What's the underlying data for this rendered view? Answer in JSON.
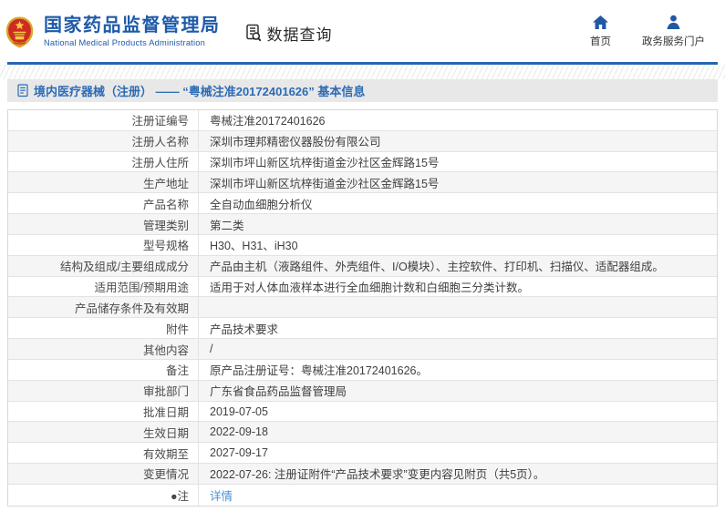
{
  "header": {
    "org_name_zh": "国家药品监督管理局",
    "org_name_en": "National Medical Products Administration",
    "data_query_label": "数据查询",
    "nav_home": "首页",
    "nav_portal": "政务服务门户"
  },
  "breadcrumb": {
    "title": "境内医疗器械（注册） —— “粤械注准20172401626” 基本信息"
  },
  "table": {
    "rows": [
      {
        "label": "注册证编号",
        "value": "粤械注准20172401626"
      },
      {
        "label": "注册人名称",
        "value": "深圳市理邦精密仪器股份有限公司"
      },
      {
        "label": "注册人住所",
        "value": "深圳市坪山新区坑梓街道金沙社区金辉路15号"
      },
      {
        "label": "生产地址",
        "value": "深圳市坪山新区坑梓街道金沙社区金辉路15号"
      },
      {
        "label": "产品名称",
        "value": "全自动血细胞分析仪"
      },
      {
        "label": "管理类别",
        "value": "第二类"
      },
      {
        "label": "型号规格",
        "value": "H30、H31、iH30"
      },
      {
        "label": "结构及组成/主要组成成分",
        "value": "产品由主机（液路组件、外壳组件、I/O模块）、主控软件、打印机、扫描仪、适配器组成。"
      },
      {
        "label": "适用范围/预期用途",
        "value": "适用于对人体血液样本进行全血细胞计数和白细胞三分类计数。"
      },
      {
        "label": "产品储存条件及有效期",
        "value": ""
      },
      {
        "label": "附件",
        "value": "产品技术要求"
      },
      {
        "label": "其他内容",
        "value": "/"
      },
      {
        "label": "备注",
        "value": "原产品注册证号：粤械注准20172401626。"
      },
      {
        "label": "审批部门",
        "value": "广东省食品药品监督管理局"
      },
      {
        "label": "批准日期",
        "value": "2019-07-05"
      },
      {
        "label": "生效日期",
        "value": "2022-09-18"
      },
      {
        "label": "有效期至",
        "value": "2027-09-17"
      },
      {
        "label": "变更情况",
        "value": "2022-07-26: 注册证附件“产品技术要求”变更内容见附页（共5页）。"
      },
      {
        "label": "●注",
        "value": "详情",
        "is_link": true
      }
    ]
  },
  "colors": {
    "brand_blue": "#1e5aa9",
    "icon_blue": "#2257a5",
    "titlebar_text": "#2d6bb4",
    "link_blue": "#4a90d9",
    "alt_row_bg": "#f5f5f5",
    "titlebar_bg": "#e8e8e8"
  }
}
